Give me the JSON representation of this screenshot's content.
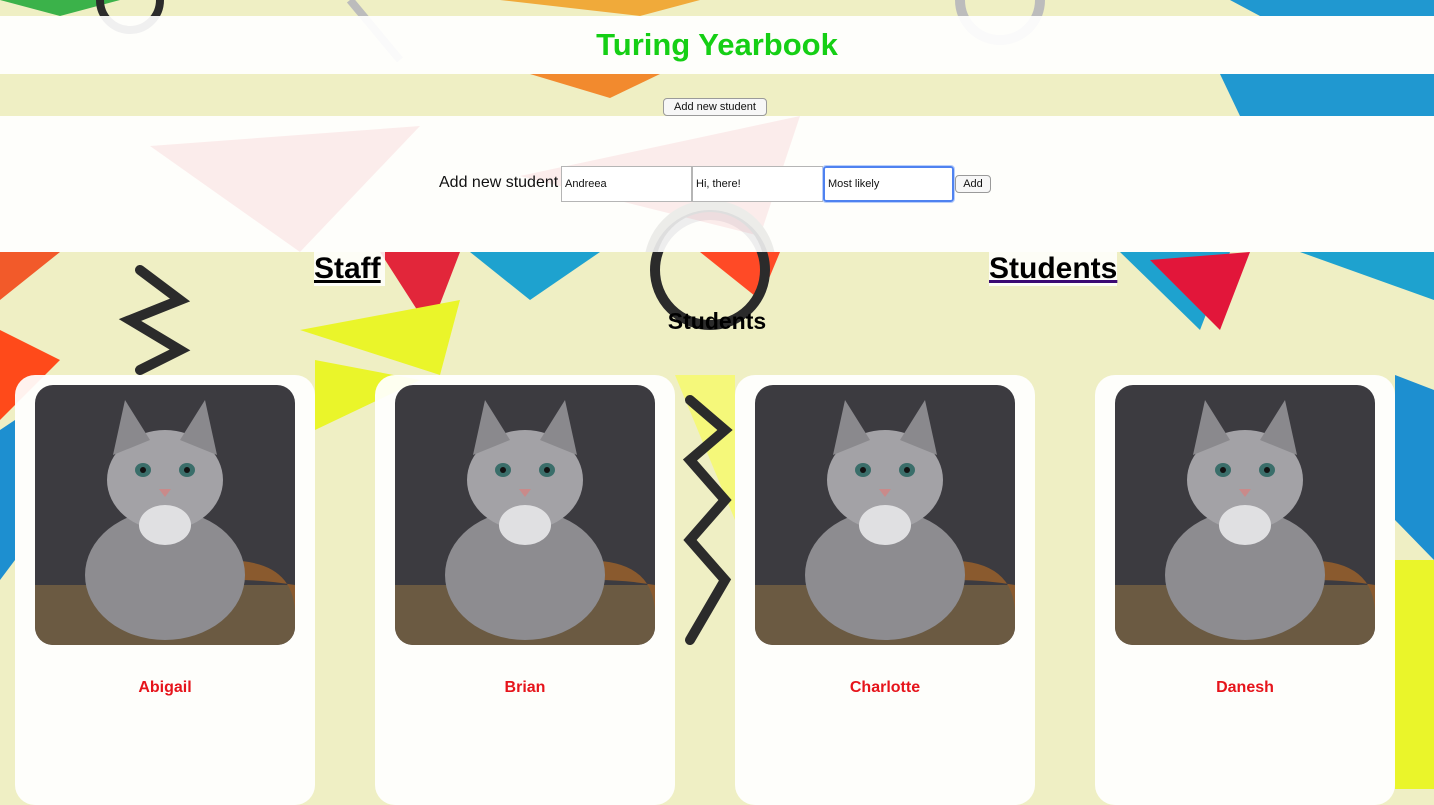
{
  "header": {
    "title": "Turing Yearbook"
  },
  "toolbar": {
    "add_toggle_label": "Add new student"
  },
  "form": {
    "label": "Add new student",
    "fields": [
      {
        "name": "name-input",
        "value": "Andreea"
      },
      {
        "name": "quote-input",
        "value": "Hi, there!"
      },
      {
        "name": "superlative-input",
        "value": "Most likely"
      }
    ],
    "submit_label": "Add"
  },
  "nav": {
    "staff_label": "Staff ",
    "students_label": "Students"
  },
  "section": {
    "title": "Students"
  },
  "students": [
    {
      "name": "Abigail"
    },
    {
      "name": "Brian"
    },
    {
      "name": "Charlotte"
    },
    {
      "name": "Danesh"
    }
  ],
  "colors": {
    "title": "#15cf15",
    "card_name": "#e6141b",
    "focus_ring": "#4f82f0"
  }
}
